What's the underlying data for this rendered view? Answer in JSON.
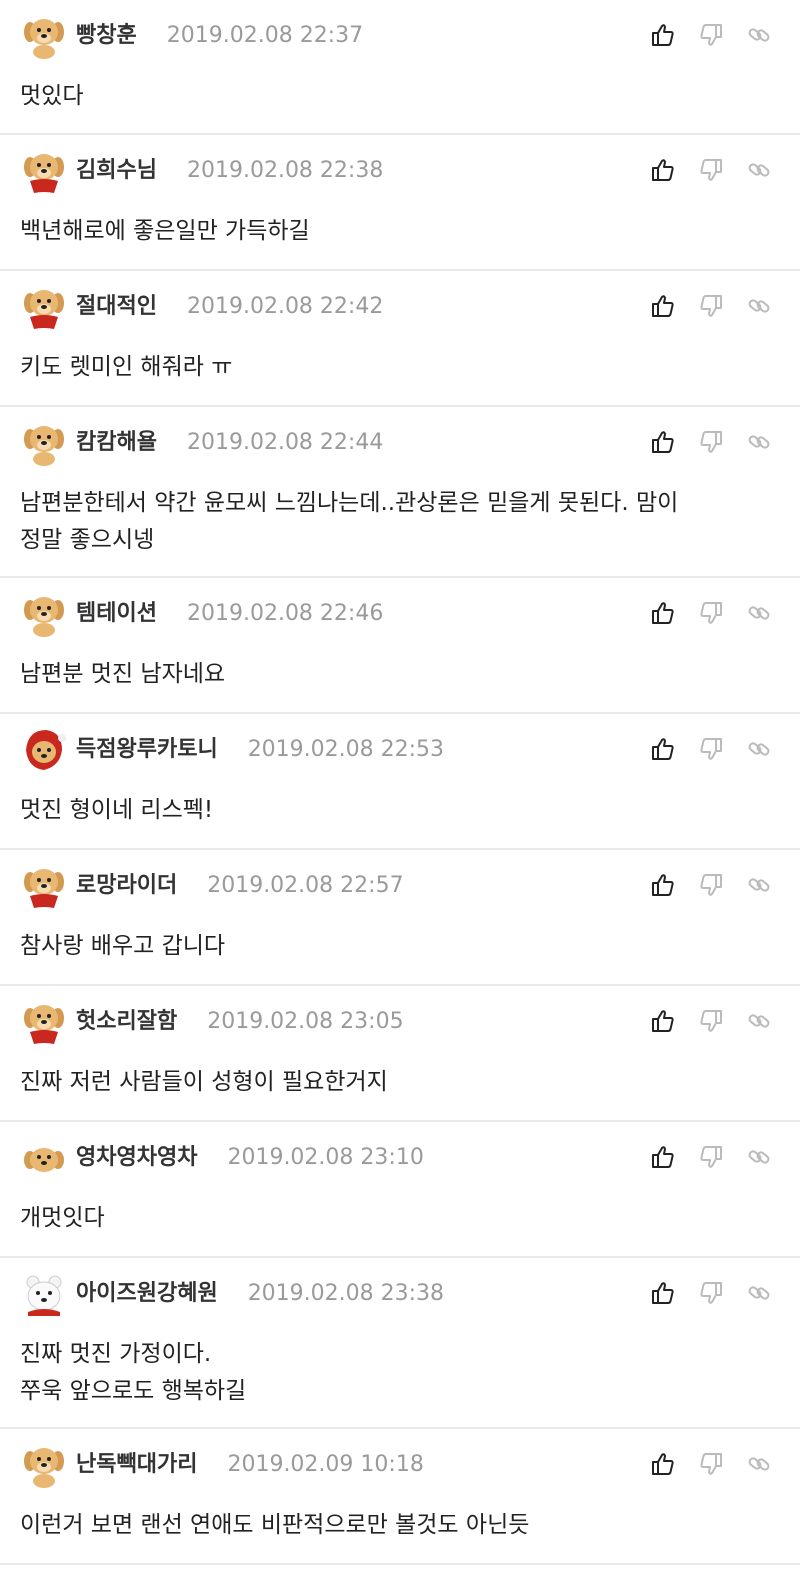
{
  "comments": [
    {
      "nickname": "빵창훈",
      "date": "2019.02.08 22:37",
      "text": "멋있다",
      "avatar": "puppy-avatar"
    },
    {
      "nickname": "김희수님",
      "date": "2019.02.08 22:38",
      "text": "백년해로에 좋은일만 가득하길",
      "avatar": "puppy-scarf-avatar"
    },
    {
      "nickname": "절대적인",
      "date": "2019.02.08 22:42",
      "text": "키도 렛미인 해줘라 ㅠ",
      "avatar": "puppy-scarf-avatar"
    },
    {
      "nickname": "캄캄해욜",
      "date": "2019.02.08 22:44",
      "text": "남편분한테서 약간 윤모씨 느낌나는데..관상론은 믿을게 못된다. 맘이\n정말 좋으시넹",
      "avatar": "puppy-avatar"
    },
    {
      "nickname": "템테이션",
      "date": "2019.02.08 22:46",
      "text": "남편분 멋진 남자네요",
      "avatar": "puppy-avatar"
    },
    {
      "nickname": "득점왕루카토니",
      "date": "2019.02.08 22:53",
      "text": "멋진 형이네 리스펙!",
      "avatar": "puppy-hood-avatar"
    },
    {
      "nickname": "로망라이더",
      "date": "2019.02.08 22:57",
      "text": "참사랑 배우고 갑니다",
      "avatar": "puppy-scarf-avatar"
    },
    {
      "nickname": "헛소리잘함",
      "date": "2019.02.08 23:05",
      "text": "진짜 저런 사람들이 성형이 필요한거지",
      "avatar": "puppy-scarf-avatar"
    },
    {
      "nickname": "영차영차영차",
      "date": "2019.02.08 23:10",
      "text": "개멋잇다",
      "avatar": "puppy-lying-avatar"
    },
    {
      "nickname": "아이즈원강혜원",
      "date": "2019.02.08 23:38",
      "text": "진짜 멋진 가정이다.\n쭈욱 앞으로도 행복하길",
      "avatar": "polar-bear-avatar"
    },
    {
      "nickname": "난독빽대가리",
      "date": "2019.02.09 10:18",
      "text": "이런거 보면 랜선 연애도 비판적으로만 볼것도 아닌듯",
      "avatar": "puppy-avatar"
    }
  ],
  "actions": {
    "like_icon": "thumbs-up-icon",
    "dislike_icon": "thumbs-down-icon",
    "share_icon": "link-icon"
  },
  "colors": {
    "separator": "#e9e9e9",
    "date_text": "#9a9a9a",
    "nickname": "#333333",
    "puppy_fur": "#e8b873",
    "scarf": "#c8281e"
  }
}
